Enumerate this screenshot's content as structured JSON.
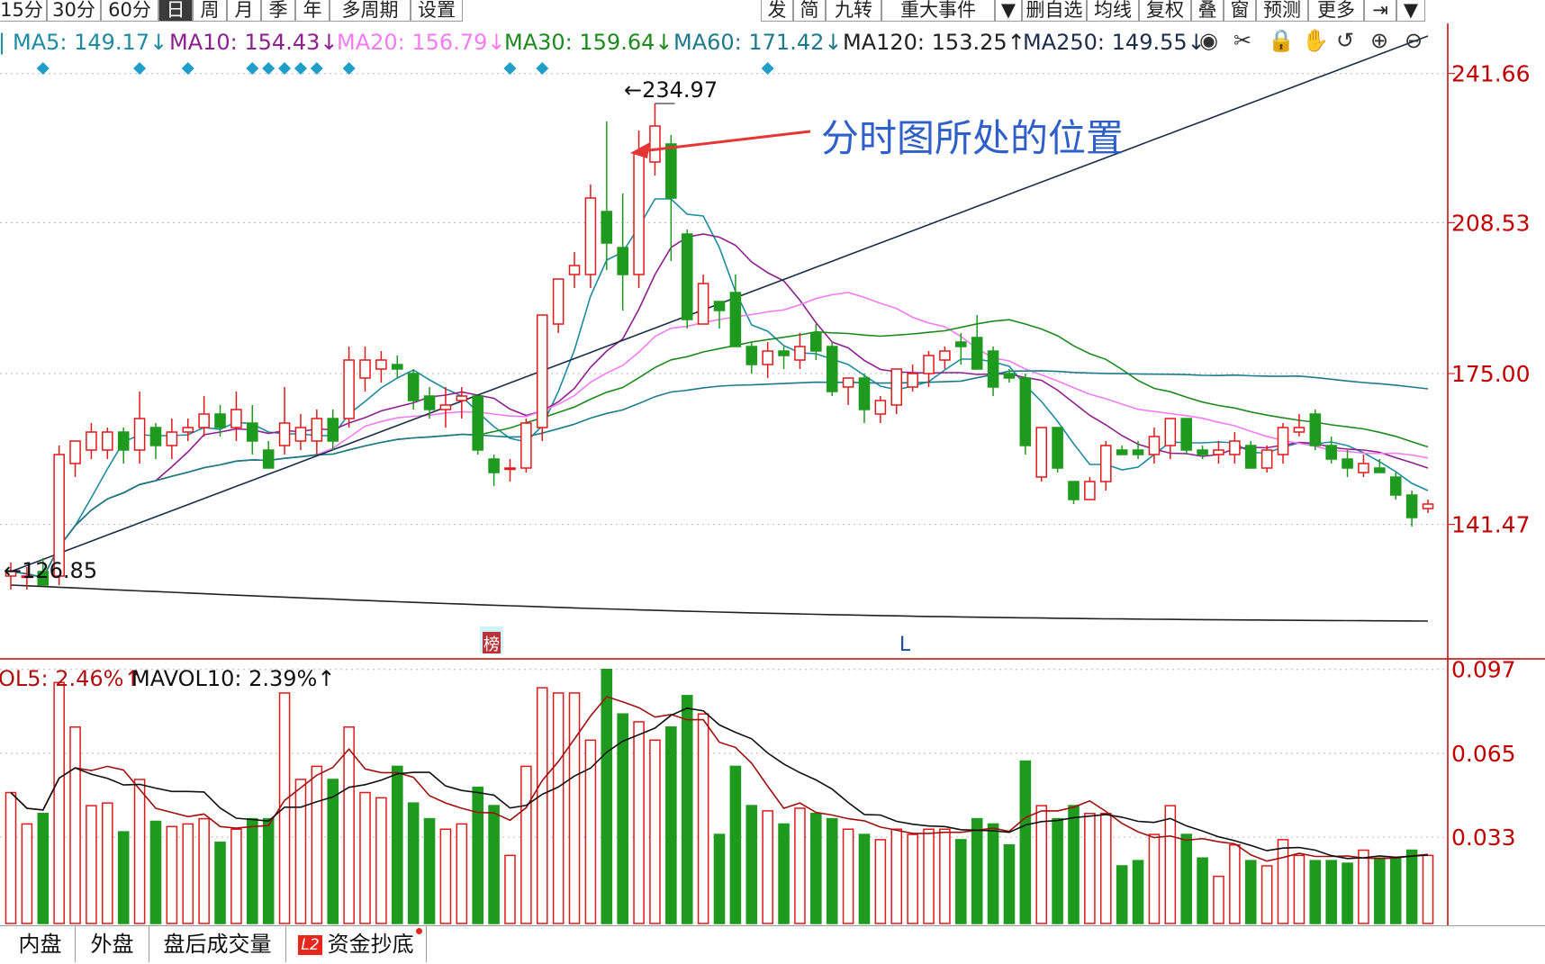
{
  "toolbar": {
    "left": [
      {
        "label": "15分",
        "active": false
      },
      {
        "label": "30分",
        "active": false
      },
      {
        "label": "60分",
        "active": false
      },
      {
        "label": "日",
        "active": true
      },
      {
        "label": "周",
        "active": false
      },
      {
        "label": "月",
        "active": false
      },
      {
        "label": "季",
        "active": false
      },
      {
        "label": "年",
        "active": false
      },
      {
        "label": "多周期",
        "active": false
      },
      {
        "label": "设置",
        "active": false
      }
    ],
    "right": [
      "发",
      "简",
      "九转",
      "重大事件",
      "删自选",
      "均线",
      "复权",
      "叠",
      "窗",
      "预测",
      "更多"
    ]
  },
  "ma_legend": [
    {
      "label": "MA5: 149.17↓",
      "color": "#1d8ba0"
    },
    {
      "label": "MA10: 154.43↓",
      "color": "#8e1f8e"
    },
    {
      "label": "MA20: 156.79↓",
      "color": "#f37cf3"
    },
    {
      "label": "MA30: 159.64↓",
      "color": "#1e8a1e"
    },
    {
      "label": "MA60: 171.42↓",
      "color": "#1d7a8a"
    },
    {
      "label": "MA120: 153.25↑",
      "color": "#222222"
    },
    {
      "label": "MA250: 149.55↓",
      "color": "#1b2d4a"
    }
  ],
  "vol_legend": [
    {
      "label": "OL5: 2.46%↑",
      "color": "#b01010"
    },
    {
      "label": "MAVOL10: 2.39%↑",
      "color": "#111111"
    }
  ],
  "annotation": "分时图所处的位置",
  "high_label": "234.97",
  "low_label": "126.85",
  "marker_l": "L",
  "marker_bang": "榜",
  "bottom_tabs": [
    "内盘",
    "外盘",
    "盘后成交量",
    "资金抄底"
  ],
  "bottom_l2": "L2",
  "colors": {
    "up": "#e0191b",
    "down": "#1e9a1e",
    "axis": "#c00000"
  },
  "chart_data": {
    "type": "candlestick",
    "y_ticks": [
      241.66,
      208.53,
      175.0,
      141.47
    ],
    "vol_ticks": [
      0.097,
      0.065,
      0.033
    ],
    "ylim": [
      112,
      245
    ],
    "vol_ylim": [
      0,
      0.1
    ],
    "candles": [
      {
        "o": 130,
        "h": 133,
        "l": 127,
        "c": 131,
        "v": 0.05
      },
      {
        "o": 130,
        "h": 132,
        "l": 127,
        "c": 130,
        "v": 0.038
      },
      {
        "o": 131,
        "h": 134,
        "l": 129,
        "c": 128,
        "v": 0.042
      },
      {
        "o": 130,
        "h": 159,
        "l": 128,
        "c": 157,
        "v": 0.092
      },
      {
        "o": 155,
        "h": 160,
        "l": 152,
        "c": 160,
        "v": 0.075
      },
      {
        "o": 158,
        "h": 164,
        "l": 156,
        "c": 162,
        "v": 0.045
      },
      {
        "o": 158,
        "h": 163,
        "l": 156,
        "c": 162,
        "v": 0.046
      },
      {
        "o": 162,
        "h": 163,
        "l": 155,
        "c": 158,
        "v": 0.035
      },
      {
        "o": 158,
        "h": 171,
        "l": 155,
        "c": 165,
        "v": 0.055
      },
      {
        "o": 163,
        "h": 164,
        "l": 156,
        "c": 159,
        "v": 0.039
      },
      {
        "o": 159,
        "h": 165,
        "l": 156,
        "c": 162,
        "v": 0.037
      },
      {
        "o": 162,
        "h": 165,
        "l": 160,
        "c": 163,
        "v": 0.038
      },
      {
        "o": 163,
        "h": 170,
        "l": 161,
        "c": 166,
        "v": 0.04
      },
      {
        "o": 166,
        "h": 168,
        "l": 161,
        "c": 163,
        "v": 0.031
      },
      {
        "o": 163,
        "h": 171,
        "l": 160,
        "c": 167,
        "v": 0.036
      },
      {
        "o": 164,
        "h": 168,
        "l": 157,
        "c": 160,
        "v": 0.04
      },
      {
        "o": 158,
        "h": 160,
        "l": 154,
        "c": 154,
        "v": 0.04
      },
      {
        "o": 159,
        "h": 172,
        "l": 157,
        "c": 164,
        "v": 0.088
      },
      {
        "o": 160,
        "h": 166,
        "l": 158,
        "c": 163,
        "v": 0.055
      },
      {
        "o": 160,
        "h": 167,
        "l": 157,
        "c": 165,
        "v": 0.06
      },
      {
        "o": 165,
        "h": 167,
        "l": 158,
        "c": 160,
        "v": 0.055
      },
      {
        "o": 165,
        "h": 181,
        "l": 163,
        "c": 178,
        "v": 0.075
      },
      {
        "o": 174,
        "h": 181,
        "l": 171,
        "c": 178,
        "v": 0.05
      },
      {
        "o": 176,
        "h": 180,
        "l": 173,
        "c": 178,
        "v": 0.048
      },
      {
        "o": 177,
        "h": 179,
        "l": 174,
        "c": 176,
        "v": 0.06
      },
      {
        "o": 175,
        "h": 176,
        "l": 167,
        "c": 169,
        "v": 0.046
      },
      {
        "o": 170,
        "h": 172,
        "l": 165,
        "c": 167,
        "v": 0.04
      },
      {
        "o": 167,
        "h": 172,
        "l": 163,
        "c": 168,
        "v": 0.036
      },
      {
        "o": 169,
        "h": 172,
        "l": 165,
        "c": 170,
        "v": 0.038
      },
      {
        "o": 170,
        "h": 170,
        "l": 157,
        "c": 158,
        "v": 0.052
      },
      {
        "o": 156,
        "h": 157,
        "l": 150,
        "c": 153,
        "v": 0.045
      },
      {
        "o": 154,
        "h": 156,
        "l": 151,
        "c": 154,
        "v": 0.026
      },
      {
        "o": 154,
        "h": 165,
        "l": 153,
        "c": 164,
        "v": 0.06
      },
      {
        "o": 163,
        "h": 187,
        "l": 160,
        "c": 188,
        "v": 0.09
      },
      {
        "o": 186,
        "h": 195,
        "l": 184,
        "c": 196,
        "v": 0.088
      },
      {
        "o": 197,
        "h": 202,
        "l": 194,
        "c": 199,
        "v": 0.088
      },
      {
        "o": 197,
        "h": 217,
        "l": 194,
        "c": 214,
        "v": 0.07
      },
      {
        "o": 211,
        "h": 231,
        "l": 198,
        "c": 204,
        "v": 0.097
      },
      {
        "o": 203,
        "h": 215,
        "l": 189,
        "c": 197,
        "v": 0.08
      },
      {
        "o": 197,
        "h": 229,
        "l": 194,
        "c": 224,
        "v": 0.077
      },
      {
        "o": 222,
        "h": 235,
        "l": 219,
        "c": 230,
        "v": 0.07
      },
      {
        "o": 226,
        "h": 228,
        "l": 200,
        "c": 214,
        "v": 0.075
      },
      {
        "o": 206,
        "h": 207,
        "l": 185,
        "c": 187,
        "v": 0.087
      },
      {
        "o": 186,
        "h": 197,
        "l": 186,
        "c": 195,
        "v": 0.08
      },
      {
        "o": 191,
        "h": 190,
        "l": 185,
        "c": 189,
        "v": 0.034
      },
      {
        "o": 193,
        "h": 197,
        "l": 181,
        "c": 181,
        "v": 0.06
      },
      {
        "o": 181,
        "h": 182,
        "l": 175,
        "c": 177,
        "v": 0.045
      },
      {
        "o": 177,
        "h": 182,
        "l": 174,
        "c": 180,
        "v": 0.043
      },
      {
        "o": 180,
        "h": 181,
        "l": 176,
        "c": 179,
        "v": 0.038
      },
      {
        "o": 178,
        "h": 184,
        "l": 176,
        "c": 181,
        "v": 0.044
      },
      {
        "o": 184,
        "h": 186,
        "l": 178,
        "c": 180,
        "v": 0.042
      },
      {
        "o": 181,
        "h": 182,
        "l": 170,
        "c": 171,
        "v": 0.04
      },
      {
        "o": 172,
        "h": 174,
        "l": 168,
        "c": 174,
        "v": 0.036
      },
      {
        "o": 174,
        "h": 175,
        "l": 164,
        "c": 167,
        "v": 0.034
      },
      {
        "o": 166,
        "h": 170,
        "l": 164,
        "c": 169,
        "v": 0.032
      },
      {
        "o": 168,
        "h": 176,
        "l": 166,
        "c": 176,
        "v": 0.036
      },
      {
        "o": 172,
        "h": 177,
        "l": 171,
        "c": 175,
        "v": 0.034
      },
      {
        "o": 175,
        "h": 180,
        "l": 172,
        "c": 179,
        "v": 0.036
      },
      {
        "o": 178,
        "h": 181,
        "l": 176,
        "c": 180,
        "v": 0.036
      },
      {
        "o": 182,
        "h": 184,
        "l": 177,
        "c": 181,
        "v": 0.032
      },
      {
        "o": 183,
        "h": 188,
        "l": 177,
        "c": 176,
        "v": 0.04
      },
      {
        "o": 180,
        "h": 181,
        "l": 170,
        "c": 172,
        "v": 0.038
      },
      {
        "o": 175,
        "h": 176,
        "l": 173,
        "c": 174,
        "v": 0.03
      },
      {
        "o": 174,
        "h": 175,
        "l": 157,
        "c": 159,
        "v": 0.062
      },
      {
        "o": 152,
        "h": 163,
        "l": 151,
        "c": 163,
        "v": 0.045
      },
      {
        "o": 163,
        "h": 163,
        "l": 153,
        "c": 154,
        "v": 0.04
      },
      {
        "o": 151,
        "h": 151,
        "l": 146,
        "c": 147,
        "v": 0.045
      },
      {
        "o": 147,
        "h": 152,
        "l": 147,
        "c": 151,
        "v": 0.042
      },
      {
        "o": 151,
        "h": 160,
        "l": 149,
        "c": 159,
        "v": 0.042
      },
      {
        "o": 158,
        "h": 159,
        "l": 157,
        "c": 157,
        "v": 0.022
      },
      {
        "o": 158,
        "h": 160,
        "l": 156,
        "c": 157,
        "v": 0.024
      },
      {
        "o": 157,
        "h": 163,
        "l": 155,
        "c": 161,
        "v": 0.034
      },
      {
        "o": 159,
        "h": 165,
        "l": 156,
        "c": 165,
        "v": 0.045
      },
      {
        "o": 165,
        "h": 165,
        "l": 157,
        "c": 158,
        "v": 0.034
      },
      {
        "o": 158,
        "h": 159,
        "l": 156,
        "c": 157,
        "v": 0.025
      },
      {
        "o": 157,
        "h": 160,
        "l": 155,
        "c": 158,
        "v": 0.018
      },
      {
        "o": 157,
        "h": 162,
        "l": 155,
        "c": 160,
        "v": 0.03
      },
      {
        "o": 159,
        "h": 160,
        "l": 154,
        "c": 154,
        "v": 0.024
      },
      {
        "o": 154,
        "h": 159,
        "l": 153,
        "c": 158,
        "v": 0.022
      },
      {
        "o": 157,
        "h": 164,
        "l": 155,
        "c": 163,
        "v": 0.032
      },
      {
        "o": 162,
        "h": 166,
        "l": 161,
        "c": 163,
        "v": 0.026
      },
      {
        "o": 166,
        "h": 167,
        "l": 158,
        "c": 159,
        "v": 0.024
      },
      {
        "o": 159,
        "h": 161,
        "l": 155,
        "c": 156,
        "v": 0.024
      },
      {
        "o": 156,
        "h": 158,
        "l": 152,
        "c": 154,
        "v": 0.023
      },
      {
        "o": 153,
        "h": 157,
        "l": 152,
        "c": 155,
        "v": 0.028
      },
      {
        "o": 154,
        "h": 156,
        "l": 153,
        "c": 153,
        "v": 0.025
      },
      {
        "o": 152,
        "h": 153,
        "l": 147,
        "c": 148,
        "v": 0.025
      },
      {
        "o": 148,
        "h": 149,
        "l": 141,
        "c": 143,
        "v": 0.028
      },
      {
        "o": 145,
        "h": 147,
        "l": 144,
        "c": 146,
        "v": 0.026
      }
    ]
  }
}
